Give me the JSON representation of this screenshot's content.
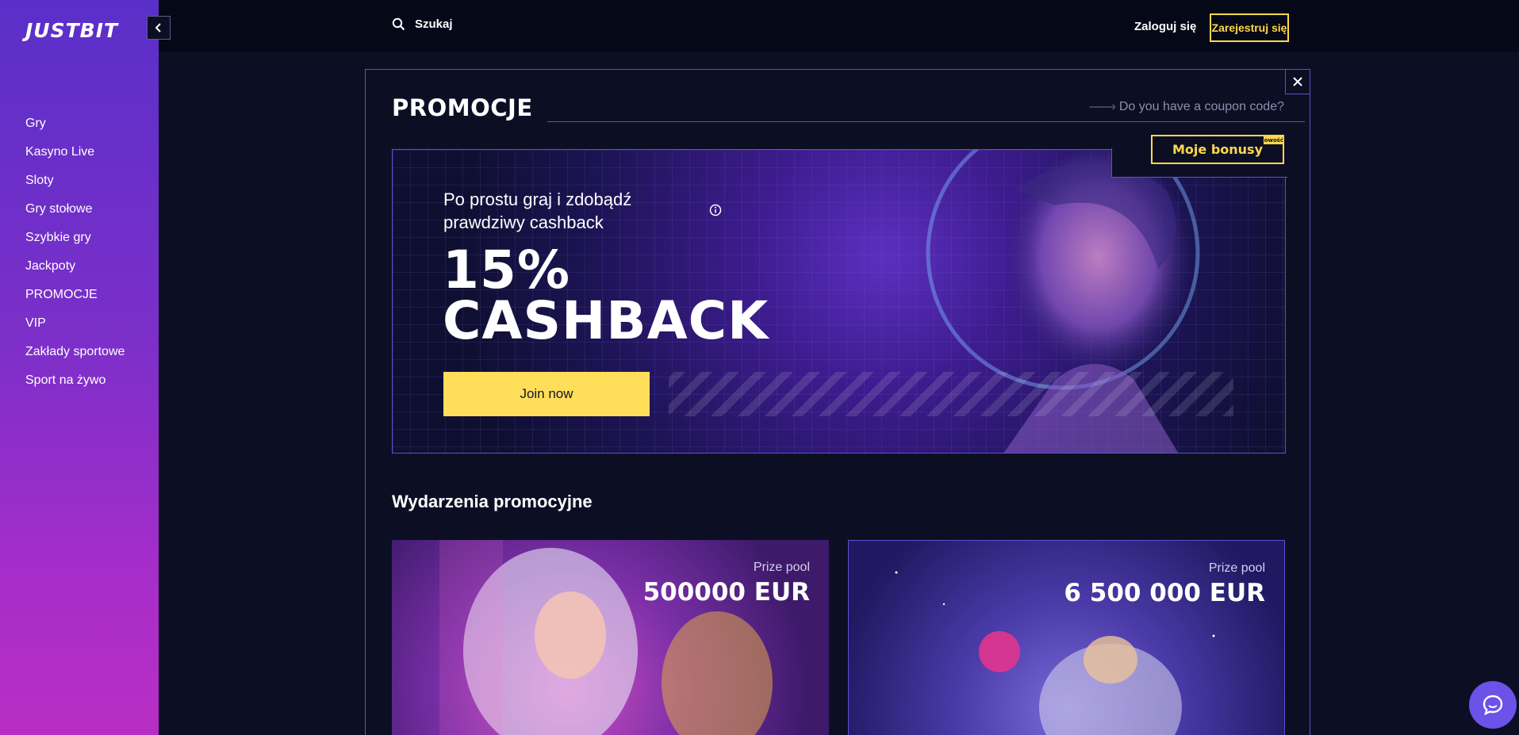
{
  "brand": {
    "logo": "JUSTBIT",
    "accent": "#ffd84a",
    "sidebar_gradient_top": "#5a2fc9",
    "sidebar_gradient_bottom": "#b92ec4"
  },
  "sidebar": {
    "items": [
      {
        "label": "Gry"
      },
      {
        "label": "Kasyno Live"
      },
      {
        "label": "Sloty"
      },
      {
        "label": "Gry stołowe"
      },
      {
        "label": "Szybkie gry"
      },
      {
        "label": "Jackpoty"
      },
      {
        "label": "PROMOCJE"
      },
      {
        "label": "VIP"
      },
      {
        "label": "Zakłady sportowe"
      },
      {
        "label": "Sport na żywo"
      }
    ]
  },
  "topbar": {
    "search_label": "Szukaj",
    "login_label": "Zaloguj się",
    "register_label": "Zarejestruj się"
  },
  "promo": {
    "title": "PROMOCJE",
    "coupon_label": "Do you have a coupon code?",
    "bonus_button": "Moje bonusy",
    "bonus_badge": "owość",
    "hero": {
      "subtitle": "Po prostu graj i zdobądź prawdziwy cashback",
      "headline_line1": "15%",
      "headline_line2": "CASHBACK",
      "cta": "Join now"
    },
    "events_title": "Wydarzenia promocyjne",
    "events": [
      {
        "prize_label": "Prize pool",
        "prize_value": "500000 EUR"
      },
      {
        "prize_label": "Prize pool",
        "prize_value": "6 500 000 EUR"
      }
    ]
  }
}
